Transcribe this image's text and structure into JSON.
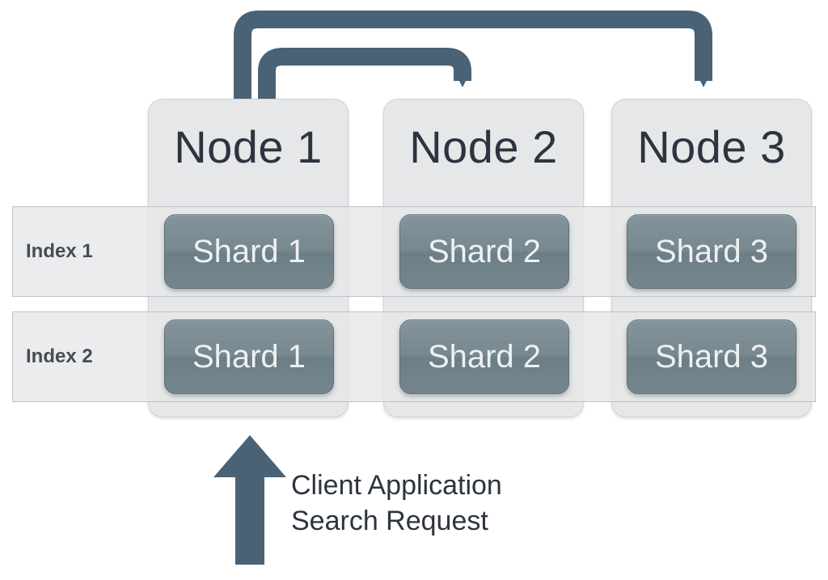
{
  "nodes": [
    {
      "title": "Node 1"
    },
    {
      "title": "Node 2"
    },
    {
      "title": "Node 3"
    }
  ],
  "rows": [
    {
      "label": "Index 1",
      "shards": [
        "Shard 1",
        "Shard 2",
        "Shard 3"
      ]
    },
    {
      "label": "Index 2",
      "shards": [
        "Shard 1",
        "Shard 2",
        "Shard 3"
      ]
    }
  ],
  "caption": {
    "line1": "Client Application",
    "line2": "Search Request"
  },
  "colors": {
    "arrow": "#4a6275",
    "nodeFill": "#e6e7e9",
    "shardFill": "#77888f"
  }
}
